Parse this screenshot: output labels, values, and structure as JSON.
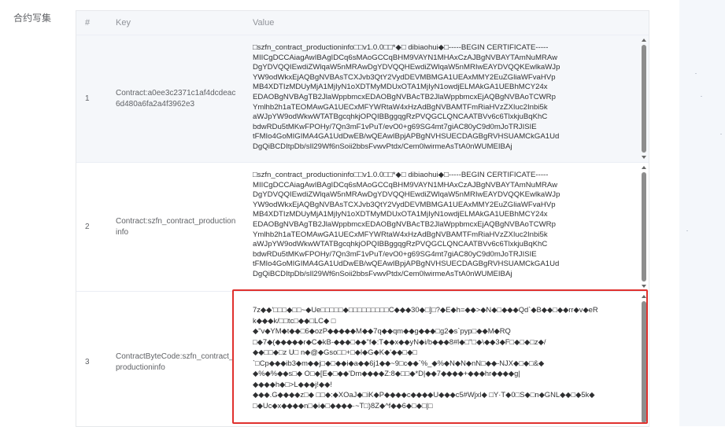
{
  "form": {
    "label": "合约写集"
  },
  "table": {
    "columns": [
      "#",
      "Key",
      "Value"
    ],
    "rows": [
      {
        "index": "1",
        "key": "Contract:a0ee3c2371c1af4dcdeac6d480a6fa2a4f3962e3",
        "value": "□szfn_contract_productioninfo□□v1.0.0□□*◆□ dibiaohui◆□-----BEGIN CERTIFICATE-----\nMIICgDCCAiagAwIBAgIDCq6sMAoGCCqBHM9VAYN1MHAxCzAJBgNVBAYTAmNuMRAw\nDgYDVQQIEwdiZWlqaW5nMRAwDgYDVQQHEwdiZWlqaW5nMRIwEAYDVQQKEwlkaWJp\nYW9odWkxEjAQBgNVBAsTCXJvb3QtY2VydDEVMBMGA1UEAxMMY2EuZGliaWFvaHVp\nMB4XDTIzMDUyMjA1MjIyN1oXDTMyMDUxOTA1MjIyN1owdjELMAkGA1UEBhMCY24x\nEDAOBgNVBAgTB2JlaWppbmcxEDAOBgNVBAcTB2JlaWppbmcxEjAQBgNVBAoTCWRp\nYmlhb2h1aTEOMAwGA1UECxMFYWRtaW4xHzAdBgNVBAMTFmRiaHVzZXIuc2Inbi5k\naWJpYW9odWkwWTATBgcqhkjOPQIBBggqgRzPVQGCLQNCAATBVv6c6TlxkjuBqKhC\nbdwRDu5tMKwFPOHy/7Qn3mF1vPuT/evO0+g69SG4mt7giAC80yC9d0mJoTRJISIE\ntFMIo4GoMIGIMA4GA1UdDwEB/wQEAwIBpjAPBgNVHSUECDAGBgRVHSUAMCkGA1Ud\nDgQiBCDItpDb/sIl29Wf6nSoii2bbsFvwvPtdx/Cem0lwirmeAsTtA0nWUMEIBAj"
      },
      {
        "index": "2",
        "key": "Contract:szfn_contract_productioninfo",
        "value": "□szfn_contract_productioninfo□□v1.0.0□□*◆□ dibiaohui◆□-----BEGIN CERTIFICATE-----\nMIICgDCCAiagAwIBAgIDCq6sMAoGCCqBHM9VAYN1MHAxCzAJBgNVBAYTAmNuMRAw\nDgYDVQQIEwdiZWlqaW5nMRAwDgYDVQQHEwdiZWlqaW5nMRIwEAYDVQQKEwlkaWJp\nYW9odWkxEjAQBgNVBAsTCXJvb3QtY2VydDEVMBMGA1UEAxMMY2EuZGliaWFvaHVp\nMB4XDTIzMDUyMjA1MjIyN1oXDTMyMDUxOTA1MjIyN1owdjELMAkGA1UEBhMCY24x\nEDAOBgNVBAgTB2JlaWppbmcxEDAOBgNVBAcTB2JlaWppbmcxEjAQBgNVBAoTCWRp\nYmlhb2h1aTEOMAwGA1UECxMFYWRtaW4xHzAdBgNVBAMTFmRiaHVzZXIuc2Inbi5k\naWJpYW9odWkwWTATBgcqhkjOPQIBBggqgRzPVQGCLQNCAATBVv6c6TlxkjuBqKhC\nbdwRDu5tMKwFPOHy/7Qn3mF1vPuT/evO0+g69SG4mt7giAC80yC9d0mJoTRJISIE\ntFMIo4GoMIGIMA4GA1UdDwEB/wQEAwIBpjAPBgNVHSUECDAGBgRVHSUAMCkGA1Ud\nDgQiBCDItpDb/sIl29Wf6nSoii2bbsFvwvPtdx/Cem0lwirmeAsTtA0nWUMEIBAj"
      },
      {
        "index": "3",
        "key": "ContractByteCode:szfn_contract_productioninfo",
        "value": "7z◆◆'□□□◆□□~◆Ue□□□□□◆□□□□□□□□□C◆◆◆30◆□]□?◆E◆h=◆◆>◆N◆□◆◆◆Qd`◆B◆◆□◆◆rr◆v◆eR\nk◆◆◆k/□□tc□◆◆□LC◆ □\n◆\"v◆YM◆t◆◆□6◆ozP◆◆◆◆◆M◆◆7q◆◆qm◆◆g◆◆◆□g2◆s`pyp□◆◆M◆RQ\n□◆7◆(◆◆◆◆◆r◆C◆kB-◆◆◆□◆◆\"f◆:T◆◆x◆◆yN◆i/b◆◆◆8#l◆□\"□◆\\◆◆3◆F□◆□◆□z◆/\n◆◆□□◆□z U□ n◆@◆Gso□□+□◆l◆G◆K◆'◆◆□◆□\n`□Cp◆◆◆ib3◆m◆◆j□◆□◆◆i◆a◆◆6j1◆◆~9□c◆◆`%_◆%◆N◆N◆nN□◆◆-NJX◆□◆□&◆\n◆%◆%◆◆s□◆ O□◆[E◆□◆◆'Dm◆◆◆◆Z:8◆□□◆*D|◆◆7◆◆◆◆+◆◆◆hr◆◆◆◆g|\n◆◆◆◆h◆□>L◆◆◆j!◆◆!\n◆◆◆.G◆◆◆◆z□◆ □□◆:◆XOaJ◆□iK◆P◆◆◆◆c◆◆◆◆U◆◆◆c5#Wjxl◆ □Y·T◆0□S◆□n◆GNL◆◆□◆5k◆\n□◆Uc◆x◆◆◆◆n□◆i◆□◆◆◆◆·~T□)8Z◆^f◆◆6◆□◆□|□"
      }
    ]
  }
}
